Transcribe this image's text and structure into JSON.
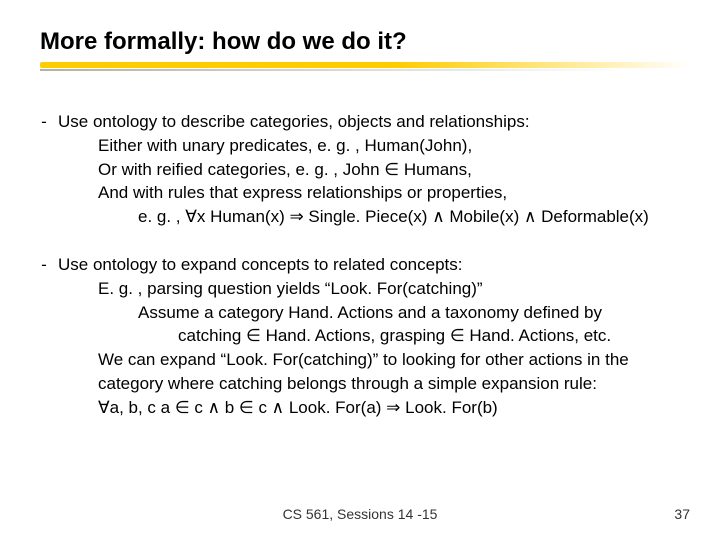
{
  "title": "More formally: how do we do it?",
  "bullets": [
    {
      "dash": "-",
      "lines": [
        {
          "text": "Use ontology to describe categories, objects and relationships:",
          "indent": 0
        },
        {
          "text": "Either with unary predicates, e. g. , Human(John),",
          "indent": 1
        },
        {
          "text": "Or with reified categories, e. g. , John ∈ Humans,",
          "indent": 1
        },
        {
          "text": "And with rules that express relationships or properties,",
          "indent": 1
        },
        {
          "text": "e. g. , ∀x Human(x) ⇒ Single. Piece(x) ∧ Mobile(x) ∧ Deformable(x)",
          "indent": 2
        }
      ]
    },
    {
      "dash": "-",
      "lines": [
        {
          "text": "Use ontology to expand concepts to related concepts:",
          "indent": 0
        },
        {
          "text": "E. g. , parsing question yields “Look. For(catching)”",
          "indent": 1
        },
        {
          "text": "Assume a category Hand. Actions and a taxonomy defined by",
          "indent": 2
        },
        {
          "text": "catching ∈ Hand. Actions, grasping ∈ Hand. Actions, etc.",
          "indent": 3
        },
        {
          "text": "We can expand “Look. For(catching)” to looking for other actions in the category where catching belongs through a simple expansion rule:",
          "indent": 1
        },
        {
          "text": "∀a, b, c   a ∈ c ∧ b ∈ c ∧ Look. For(a) ⇒ Look. For(b)",
          "indent": 1
        }
      ]
    }
  ],
  "footer_center": "CS 561,  Sessions 14 -15",
  "footer_right": "37"
}
